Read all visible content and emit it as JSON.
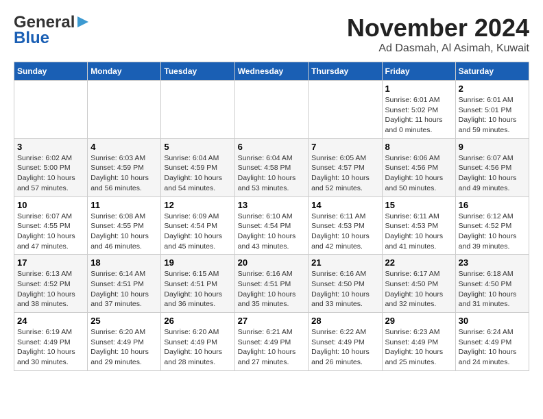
{
  "header": {
    "logo_general": "General",
    "logo_blue": "Blue",
    "month_title": "November 2024",
    "location": "Ad Dasmah, Al Asimah, Kuwait"
  },
  "days_of_week": [
    "Sunday",
    "Monday",
    "Tuesday",
    "Wednesday",
    "Thursday",
    "Friday",
    "Saturday"
  ],
  "weeks": [
    [
      {
        "day": "",
        "info": ""
      },
      {
        "day": "",
        "info": ""
      },
      {
        "day": "",
        "info": ""
      },
      {
        "day": "",
        "info": ""
      },
      {
        "day": "",
        "info": ""
      },
      {
        "day": "1",
        "info": "Sunrise: 6:01 AM\nSunset: 5:02 PM\nDaylight: 11 hours and 0 minutes."
      },
      {
        "day": "2",
        "info": "Sunrise: 6:01 AM\nSunset: 5:01 PM\nDaylight: 10 hours and 59 minutes."
      }
    ],
    [
      {
        "day": "3",
        "info": "Sunrise: 6:02 AM\nSunset: 5:00 PM\nDaylight: 10 hours and 57 minutes."
      },
      {
        "day": "4",
        "info": "Sunrise: 6:03 AM\nSunset: 4:59 PM\nDaylight: 10 hours and 56 minutes."
      },
      {
        "day": "5",
        "info": "Sunrise: 6:04 AM\nSunset: 4:59 PM\nDaylight: 10 hours and 54 minutes."
      },
      {
        "day": "6",
        "info": "Sunrise: 6:04 AM\nSunset: 4:58 PM\nDaylight: 10 hours and 53 minutes."
      },
      {
        "day": "7",
        "info": "Sunrise: 6:05 AM\nSunset: 4:57 PM\nDaylight: 10 hours and 52 minutes."
      },
      {
        "day": "8",
        "info": "Sunrise: 6:06 AM\nSunset: 4:56 PM\nDaylight: 10 hours and 50 minutes."
      },
      {
        "day": "9",
        "info": "Sunrise: 6:07 AM\nSunset: 4:56 PM\nDaylight: 10 hours and 49 minutes."
      }
    ],
    [
      {
        "day": "10",
        "info": "Sunrise: 6:07 AM\nSunset: 4:55 PM\nDaylight: 10 hours and 47 minutes."
      },
      {
        "day": "11",
        "info": "Sunrise: 6:08 AM\nSunset: 4:55 PM\nDaylight: 10 hours and 46 minutes."
      },
      {
        "day": "12",
        "info": "Sunrise: 6:09 AM\nSunset: 4:54 PM\nDaylight: 10 hours and 45 minutes."
      },
      {
        "day": "13",
        "info": "Sunrise: 6:10 AM\nSunset: 4:54 PM\nDaylight: 10 hours and 43 minutes."
      },
      {
        "day": "14",
        "info": "Sunrise: 6:11 AM\nSunset: 4:53 PM\nDaylight: 10 hours and 42 minutes."
      },
      {
        "day": "15",
        "info": "Sunrise: 6:11 AM\nSunset: 4:53 PM\nDaylight: 10 hours and 41 minutes."
      },
      {
        "day": "16",
        "info": "Sunrise: 6:12 AM\nSunset: 4:52 PM\nDaylight: 10 hours and 39 minutes."
      }
    ],
    [
      {
        "day": "17",
        "info": "Sunrise: 6:13 AM\nSunset: 4:52 PM\nDaylight: 10 hours and 38 minutes."
      },
      {
        "day": "18",
        "info": "Sunrise: 6:14 AM\nSunset: 4:51 PM\nDaylight: 10 hours and 37 minutes."
      },
      {
        "day": "19",
        "info": "Sunrise: 6:15 AM\nSunset: 4:51 PM\nDaylight: 10 hours and 36 minutes."
      },
      {
        "day": "20",
        "info": "Sunrise: 6:16 AM\nSunset: 4:51 PM\nDaylight: 10 hours and 35 minutes."
      },
      {
        "day": "21",
        "info": "Sunrise: 6:16 AM\nSunset: 4:50 PM\nDaylight: 10 hours and 33 minutes."
      },
      {
        "day": "22",
        "info": "Sunrise: 6:17 AM\nSunset: 4:50 PM\nDaylight: 10 hours and 32 minutes."
      },
      {
        "day": "23",
        "info": "Sunrise: 6:18 AM\nSunset: 4:50 PM\nDaylight: 10 hours and 31 minutes."
      }
    ],
    [
      {
        "day": "24",
        "info": "Sunrise: 6:19 AM\nSunset: 4:49 PM\nDaylight: 10 hours and 30 minutes."
      },
      {
        "day": "25",
        "info": "Sunrise: 6:20 AM\nSunset: 4:49 PM\nDaylight: 10 hours and 29 minutes."
      },
      {
        "day": "26",
        "info": "Sunrise: 6:20 AM\nSunset: 4:49 PM\nDaylight: 10 hours and 28 minutes."
      },
      {
        "day": "27",
        "info": "Sunrise: 6:21 AM\nSunset: 4:49 PM\nDaylight: 10 hours and 27 minutes."
      },
      {
        "day": "28",
        "info": "Sunrise: 6:22 AM\nSunset: 4:49 PM\nDaylight: 10 hours and 26 minutes."
      },
      {
        "day": "29",
        "info": "Sunrise: 6:23 AM\nSunset: 4:49 PM\nDaylight: 10 hours and 25 minutes."
      },
      {
        "day": "30",
        "info": "Sunrise: 6:24 AM\nSunset: 4:49 PM\nDaylight: 10 hours and 24 minutes."
      }
    ]
  ]
}
